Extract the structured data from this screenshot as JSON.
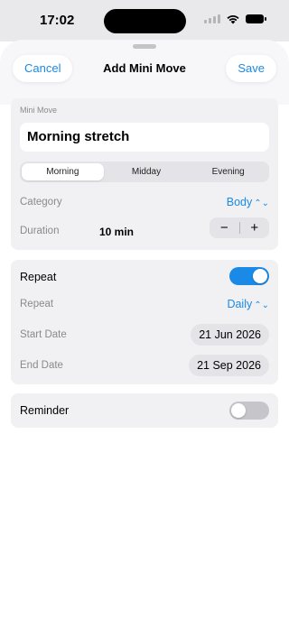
{
  "status_bar": {
    "time": "17:02"
  },
  "nav": {
    "cancel": "Cancel",
    "title": "Add Mini Move",
    "save": "Save"
  },
  "mini_move": {
    "section_label": "Mini Move",
    "name_value": "Morning stretch",
    "segments": [
      "Morning",
      "Midday",
      "Evening"
    ],
    "selected_segment": "Morning",
    "category_label": "Category",
    "category_value": "Body",
    "duration_label": "Duration",
    "duration_value": "10 min",
    "stepper_minus": "−",
    "stepper_plus": "+"
  },
  "repeat": {
    "toggle_label": "Repeat",
    "toggle_on": true,
    "frequency_label": "Repeat",
    "frequency_value": "Daily",
    "start_label": "Start Date",
    "start_value": "21 Jun 2026",
    "end_label": "End Date",
    "end_value": "21 Sep 2026"
  },
  "reminder": {
    "label": "Reminder",
    "toggle_on": false
  },
  "icons": {
    "chevron": "up-down-chevron-icon",
    "wifi": "wifi-icon",
    "battery": "battery-icon",
    "cellular": "cellular-signal-icon"
  },
  "colors": {
    "accent": "#1a8ae6",
    "card": "#f1f1f4",
    "toggle_off": "#c6c6ca"
  }
}
